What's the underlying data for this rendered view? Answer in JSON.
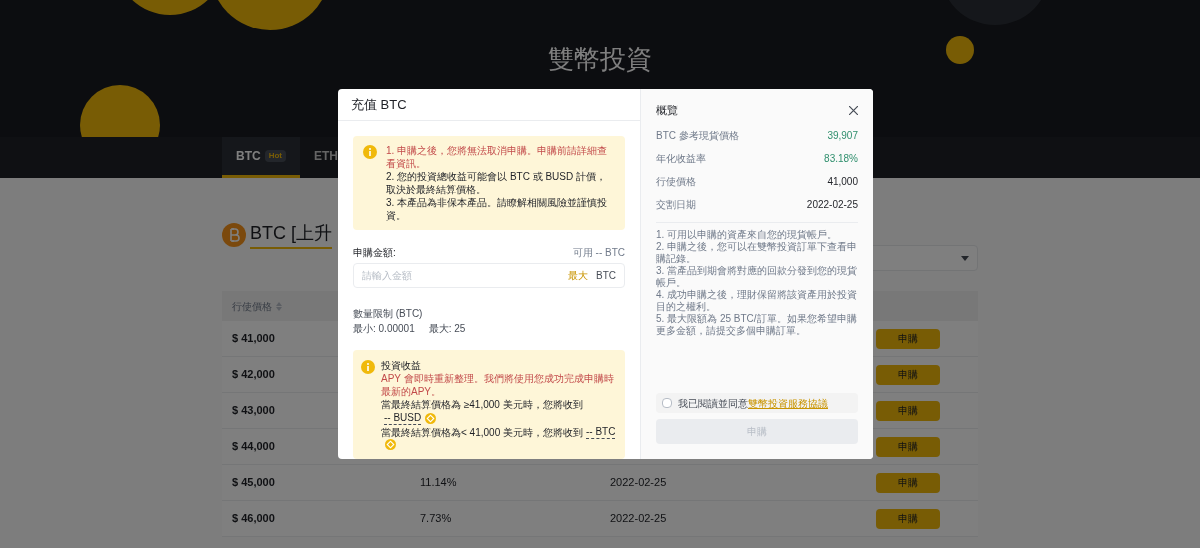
{
  "page_title": "雙幣投資",
  "tabs": [
    {
      "label": "BTC",
      "badge": "Hot",
      "selected": true
    },
    {
      "label": "ETH",
      "selected": false
    }
  ],
  "section_title": "BTC [上升",
  "table": {
    "columns": [
      "行使價格"
    ],
    "rows": [
      {
        "price": "$ 41,000",
        "action": "申購"
      },
      {
        "price": "$ 42,000",
        "action": "申購"
      },
      {
        "price": "$ 43,000",
        "action": "申購"
      },
      {
        "price": "$ 44,000",
        "action": "申購"
      },
      {
        "price": "$ 45,000",
        "apy": "11.14%",
        "date": "2022-02-25",
        "action": "申購"
      },
      {
        "price": "$ 46,000",
        "apy": "7.73%",
        "date": "2022-02-25",
        "action": "申購"
      }
    ]
  },
  "modal": {
    "title": "充值 BTC",
    "warning": [
      {
        "text": "1. 申購之後，您將無法取消申購。申購前請詳細查看資訊。",
        "emphasis": true
      },
      {
        "text": "2. 您的投資總收益可能會以 BTC 或 BUSD 計價，取決於最終結算價格。",
        "emphasis": false
      },
      {
        "text": "3. 本產品為非保本產品。請瞭解相關風險並謹慎投資。",
        "emphasis": false
      }
    ],
    "amount": {
      "label": "申購金額:",
      "available": "可用 -- BTC",
      "placeholder": "請輸入金額",
      "max": "最大",
      "unit": "BTC"
    },
    "limit": {
      "title": "數量限制 (BTC)",
      "min": "最小: 0.00001",
      "max": "最大: 25"
    },
    "earnings": {
      "title": "投資收益",
      "note": "APY 會即時重新整理。我們將使用您成功完成申購時最新的APY。",
      "lines": [
        {
          "text": "當最終結算價格為 ≥41,000 美元時，您將收到",
          "value": "-- BUSD"
        },
        {
          "text": "當最終結算價格為< 41,000 美元時，您將收到",
          "value": "-- BTC"
        }
      ]
    },
    "overview": {
      "title": "概覽",
      "rows": [
        {
          "label": "BTC 參考現貨價格",
          "value": "39,907",
          "highlight": true
        },
        {
          "label": "年化收益率",
          "value": "83.18%",
          "highlight": true
        },
        {
          "label": "行使價格",
          "value": "41,000",
          "highlight": false
        },
        {
          "label": "交割日期",
          "value": "2022-02-25",
          "highlight": false
        }
      ],
      "notes": [
        "1. 可用以申購的資產來自您的現貨帳戶。",
        "2. 申購之後，您可以在雙幣投資訂單下查看申購記錄。",
        "3. 當產品到期會將對應的回款分發到您的現貨帳戶。",
        "4. 成功申購之後，理財保留將該資產用於投資目的之權利。",
        "5. 最大限額為 25 BTC/訂單。如果您希望申購更多金額，請提交多個申購訂單。"
      ]
    },
    "agreement": {
      "checked": false,
      "text": "我已閱讀並同意",
      "link": "雙幣投資服務協議"
    },
    "submit": {
      "label": "申購",
      "disabled": true
    }
  }
}
